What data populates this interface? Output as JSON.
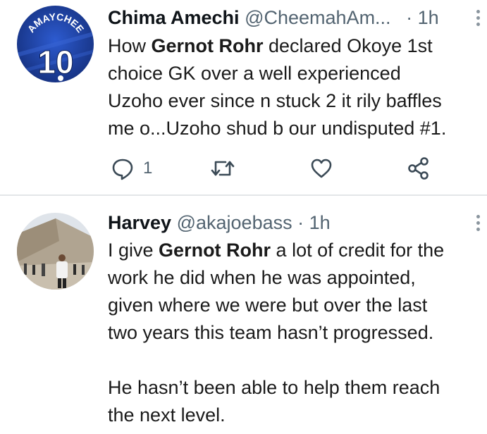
{
  "tweets": [
    {
      "display_name": "Chima Amechi",
      "handle": "@CheemahAm...",
      "time": "· 1h",
      "avatar_text": "AMAYCHEE",
      "avatar_number": "10",
      "body_lines": [
        [
          "How ",
          "Gernot Rohr",
          " declared Okoye 1st"
        ],
        [
          "choice GK over a well experienced",
          "",
          ""
        ],
        [
          "Uzoho ever since n stuck 2 it rily baffles",
          "",
          ""
        ],
        [
          "me o...Uzoho shud b our undisputed #1.",
          "",
          ""
        ]
      ],
      "reply_count": "1"
    },
    {
      "display_name": "Harvey",
      "handle": "@akajoebass",
      "time": "· 1h",
      "body_lines": [
        [
          "I give ",
          "Gernot Rohr",
          " a lot of credit for the"
        ],
        [
          "work he did when he was appointed,",
          "",
          ""
        ],
        [
          "given where we were but over the last",
          "",
          ""
        ],
        [
          "two years this team hasn’t progressed.",
          "",
          ""
        ],
        [
          "",
          "",
          ""
        ],
        [
          "He hasn’t been able to help them reach",
          "",
          ""
        ],
        [
          "the next level.",
          "",
          ""
        ]
      ]
    }
  ],
  "icons": {
    "reply": "reply-icon",
    "retweet": "retweet-icon",
    "like": "like-icon",
    "share": "share-icon",
    "more": "more-vertical-icon"
  },
  "colors": {
    "text": "#0f1419",
    "secondary": "#536471",
    "icon": "#3b4a56",
    "avatar1_bg": "#1d3f9c",
    "divider": "#e3e6e8"
  }
}
